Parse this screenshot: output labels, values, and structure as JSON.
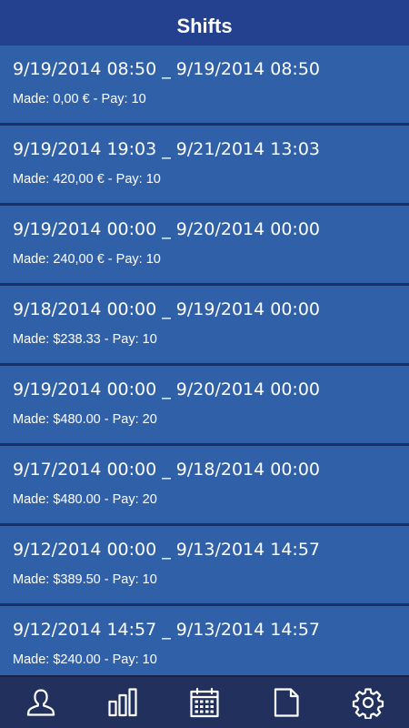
{
  "header": {
    "title": "Shifts"
  },
  "shifts": [
    {
      "dates": "9/19/2014 08:50 _ 9/19/2014 08:50",
      "meta": "Made: 0,00 € - Pay: 10"
    },
    {
      "dates": "9/19/2014 19:03 _ 9/21/2014 13:03",
      "meta": "Made: 420,00 € - Pay: 10"
    },
    {
      "dates": "9/19/2014 00:00 _ 9/20/2014 00:00",
      "meta": "Made: 240,00 € - Pay: 10"
    },
    {
      "dates": "9/18/2014 00:00 _ 9/19/2014 00:00",
      "meta": "Made: $238.33 - Pay: 10"
    },
    {
      "dates": "9/19/2014 00:00 _ 9/20/2014 00:00",
      "meta": "Made: $480.00 - Pay: 20"
    },
    {
      "dates": "9/17/2014 00:00 _ 9/18/2014 00:00",
      "meta": "Made: $480.00 - Pay: 20"
    },
    {
      "dates": "9/12/2014 00:00 _ 9/13/2014 14:57",
      "meta": "Made: $389.50 - Pay: 10"
    },
    {
      "dates": "9/12/2014 14:57 _ 9/13/2014 14:57",
      "meta": "Made: $240.00 - Pay: 10"
    }
  ],
  "tabbar": {
    "tabs": [
      {
        "icon": "person-icon"
      },
      {
        "icon": "bar-chart-icon"
      },
      {
        "icon": "calendar-icon"
      },
      {
        "icon": "document-icon"
      },
      {
        "icon": "gear-icon"
      }
    ]
  },
  "colors": {
    "header": "#23418f",
    "row": "#3060a8",
    "row_divider": "#1b2f66",
    "tabbar": "#22305e",
    "text": "#ffffff"
  }
}
